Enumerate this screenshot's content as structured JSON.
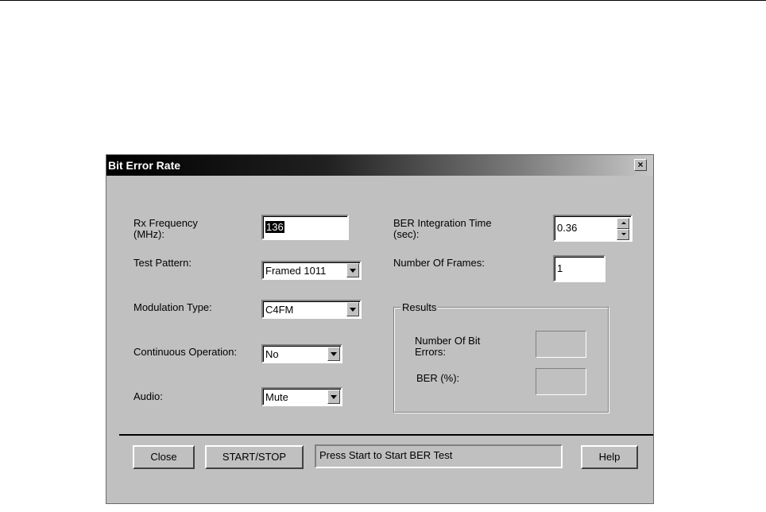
{
  "dialog": {
    "title": "Bit Error Rate",
    "close_glyph": "×"
  },
  "fields": {
    "rx_frequency": {
      "label_line1": "Rx Frequency",
      "label_line2": "(MHz):",
      "value": "136"
    },
    "test_pattern": {
      "label": "Test Pattern:",
      "value": "Framed 1011"
    },
    "modulation_type": {
      "label": "Modulation Type:",
      "value": "C4FM"
    },
    "continuous_operation": {
      "label": "Continuous Operation:",
      "value": "No"
    },
    "audio": {
      "label": "Audio:",
      "value": "Mute"
    },
    "ber_integration_time": {
      "label_line1": "BER Integration Time",
      "label_line2": "(sec):",
      "value": "0.36"
    },
    "number_of_frames": {
      "label": "Number Of Frames:",
      "value": "1"
    }
  },
  "results": {
    "title": "Results",
    "bit_errors_label_line1": "Number Of Bit",
    "bit_errors_label_line2": "Errors:",
    "bit_errors_value": "",
    "ber_label": "BER (%):",
    "ber_value": ""
  },
  "buttons": {
    "close": "Close",
    "start_stop": "START/STOP",
    "help": "Help"
  },
  "status_text": "Press Start to Start BER Test"
}
